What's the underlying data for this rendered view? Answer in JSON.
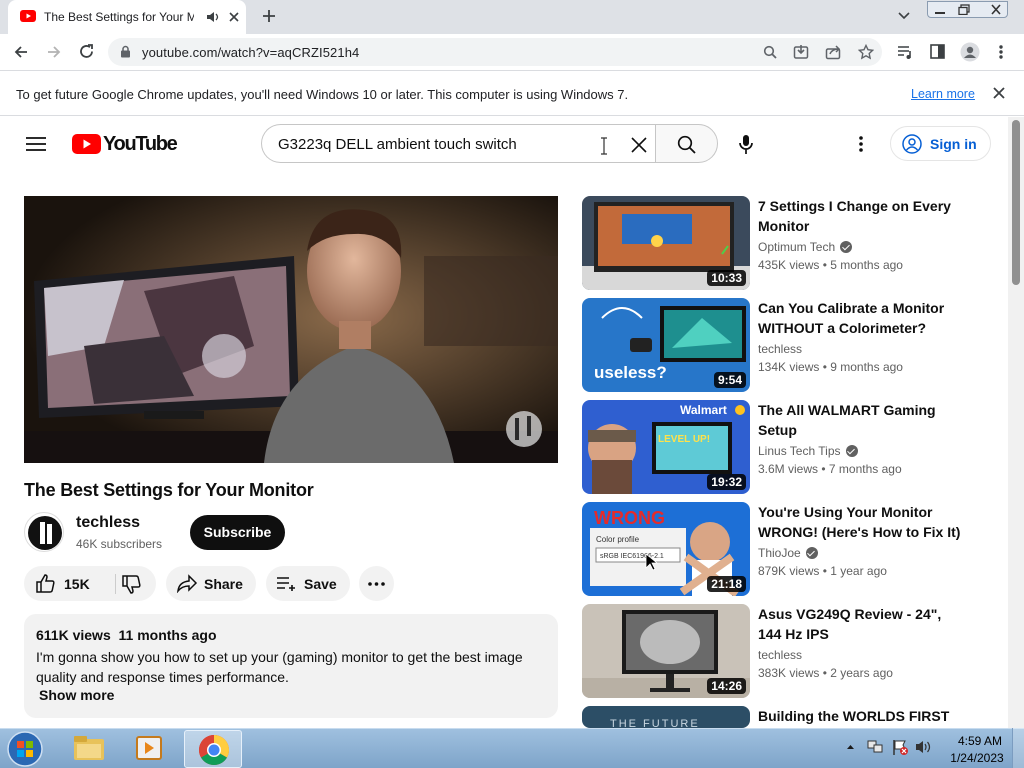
{
  "browser": {
    "tab_title": "The Best Settings for Your Monitor",
    "url": "youtube.com/watch?v=aqCRZI521h4",
    "info_message": "To get future Google Chrome updates, you'll need Windows 10 or later. This computer is using Windows 7.",
    "info_link": "Learn more"
  },
  "youtube": {
    "logo_text": "YouTube",
    "search_query": "G3223q DELL ambient touch switch",
    "sign_in": "Sign in"
  },
  "video": {
    "title": "The Best Settings for Your Monitor",
    "channel": "techless",
    "subscribers": "46K subscribers",
    "subscribe": "Subscribe",
    "likes": "15K",
    "share": "Share",
    "save": "Save",
    "views": "611K views",
    "age": "11 months ago",
    "description": "I'm gonna show you how to set up your (gaming) monitor to get the best image quality and response times performance.",
    "show_more": "Show more"
  },
  "recommendations": [
    {
      "title": "7 Settings I Change on Every Monitor",
      "channel": "Optimum Tech",
      "verified": true,
      "views": "435K views",
      "age": "5 months ago",
      "duration": "10:33"
    },
    {
      "title": "Can You Calibrate a Monitor WITHOUT a Colorimeter?",
      "channel": "techless",
      "verified": false,
      "views": "134K views",
      "age": "9 months ago",
      "duration": "9:54"
    },
    {
      "title": "The All WALMART Gaming Setup",
      "channel": "Linus Tech Tips",
      "verified": true,
      "views": "3.6M views",
      "age": "7 months ago",
      "duration": "19:32"
    },
    {
      "title": "You're Using Your Monitor WRONG! (Here's How to Fix It)",
      "channel": "ThioJoe",
      "verified": true,
      "views": "879K views",
      "age": "1 year ago",
      "duration": "21:18"
    },
    {
      "title": "Asus VG249Q Review - 24\", 144 Hz IPS",
      "channel": "techless",
      "verified": false,
      "views": "383K views",
      "age": "2 years ago",
      "duration": "14:26"
    },
    {
      "title": "Building the WORLDS FIRST",
      "channel": "",
      "verified": false,
      "views": "",
      "age": "",
      "duration": ""
    }
  ],
  "thumb_text": {
    "useless": "useless?",
    "walmart": "Walmart",
    "level_up": "LEVEL UP!",
    "wrong": "WRONG",
    "color_profile": "Color profile",
    "srgb": "sRGB IEC61966-2.1",
    "future": "THE FUTURE"
  },
  "taskbar": {
    "time": "4:59 AM",
    "date": "1/24/2023"
  },
  "colors": {
    "youtube_red": "#ff0000",
    "link_blue": "#065fd4",
    "chrome_link": "#1a73e8"
  }
}
